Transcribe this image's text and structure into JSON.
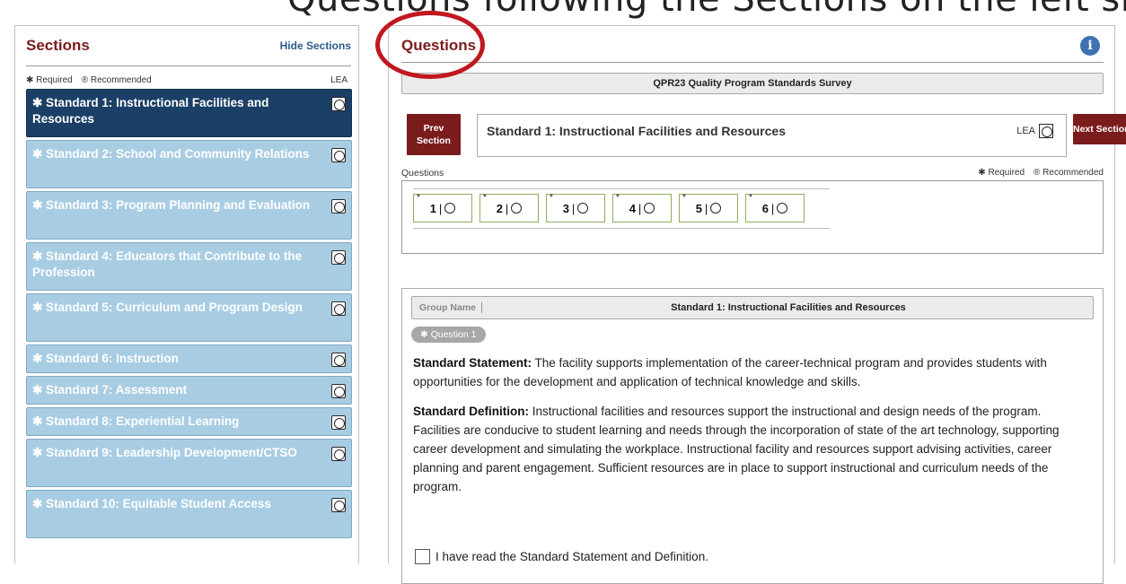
{
  "header_crop_text": "Questions following  the  Sections on the left side, with the same Standard as the Survey Section",
  "sections": {
    "title": "Sections",
    "hide_label": "Hide Sections",
    "legend_required": "✱ Required",
    "legend_recommended": "® Recommended",
    "lea_label": "LEA",
    "items": [
      {
        "label": "✱ Standard 1: Instructional Facilities and Resources",
        "active": true
      },
      {
        "label": "✱ Standard 2: School and Community Relations",
        "active": false
      },
      {
        "label": "✱ Standard 3: Program Planning and Evaluation",
        "active": false
      },
      {
        "label": "✱ Standard 4: Educators that Contribute to the Profession",
        "active": false
      },
      {
        "label": "✱ Standard 5: Curriculum and Program Design",
        "active": false
      },
      {
        "label": "✱ Standard 6: Instruction",
        "active": false
      },
      {
        "label": "✱ Standard 7: Assessment",
        "active": false
      },
      {
        "label": "✱ Standard 8: Experiential Learning",
        "active": false
      },
      {
        "label": "✱ Standard 9: Leadership Development/CTSO",
        "active": false
      },
      {
        "label": "✱ Standard 10: Equitable Student Access",
        "active": false
      }
    ]
  },
  "questions": {
    "title": "Questions",
    "survey_name": "QPR23 Quality Program Standards Survey",
    "prev_label_1": "Prev",
    "prev_label_2": "Section",
    "next_label": "Next Section",
    "standard_title": "Standard 1: Instructional Facilities and Resources",
    "lea_label": "LEA",
    "list_label": "Questions",
    "legend_required": "✱ Required",
    "legend_recommended": "® Recommended",
    "tiles": [
      {
        "star": "*",
        "num": "1",
        "sep": "|"
      },
      {
        "star": "*",
        "num": "2",
        "sep": "|"
      },
      {
        "star": "*",
        "num": "3",
        "sep": "|"
      },
      {
        "star": "*",
        "num": "4",
        "sep": "|"
      },
      {
        "star": "*",
        "num": "5",
        "sep": "|"
      },
      {
        "star": "*",
        "num": "6",
        "sep": "|"
      }
    ]
  },
  "detail": {
    "group_name_label": "Group Name",
    "group_title": "Standard 1: Instructional Facilities and Resources",
    "question_pill": "✱ Question 1",
    "statement_label": "Standard Statement:",
    "statement_text": " The facility supports implementation of the career-technical program and provides students with opportunities for the development and application of technical knowledge and skills.",
    "definition_label": "Standard Definition:",
    "definition_text": " Instructional facilities and resources support the instructional and design needs of the program. Facilities are conducive to student learning and needs through the incorporation of state of the art technology, supporting career development and simulating the workplace. Instructional facility and resources support advising activities, career planning and parent engagement. Sufficient resources are in place to support instructional and curriculum needs of the program.",
    "ack_label": "I have read the Standard Statement and Definition."
  },
  "colors": {
    "accent_maroon": "#7b1c1c",
    "active_section": "#1b3f66",
    "section_bg": "#a8cde3",
    "annotation_red": "#c0181f"
  }
}
